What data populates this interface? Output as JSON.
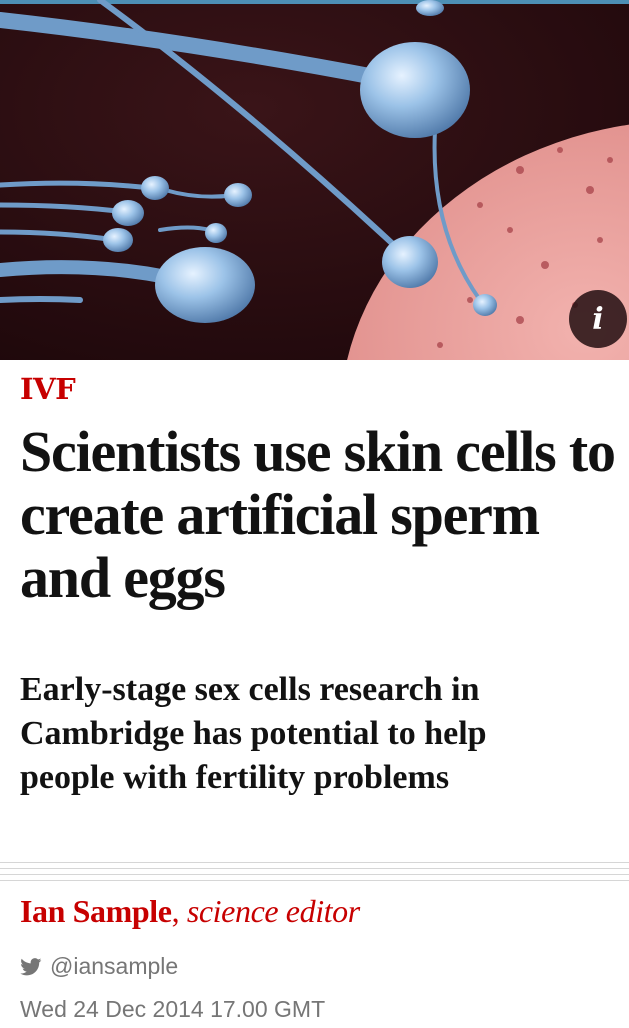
{
  "article": {
    "section": "IVF",
    "headline": "Scientists use skin cells to create artificial sperm and eggs",
    "standfirst": "Early-stage sex cells research in Cambridge has potential to help people with fertility problems",
    "byline": {
      "author": "Ian Sample",
      "separator": ",",
      "role": "science editor"
    },
    "twitter_handle": "@iansample",
    "published": "Wed 24 Dec 2014 17.00 GMT"
  },
  "hero": {
    "info_label": "i",
    "info_icon": "info-icon"
  },
  "icons": {
    "twitter": "twitter-bird-icon"
  },
  "colors": {
    "accent": "#c70000",
    "text": "#121212",
    "meta": "#767676",
    "rule": "#d6d6d6"
  }
}
